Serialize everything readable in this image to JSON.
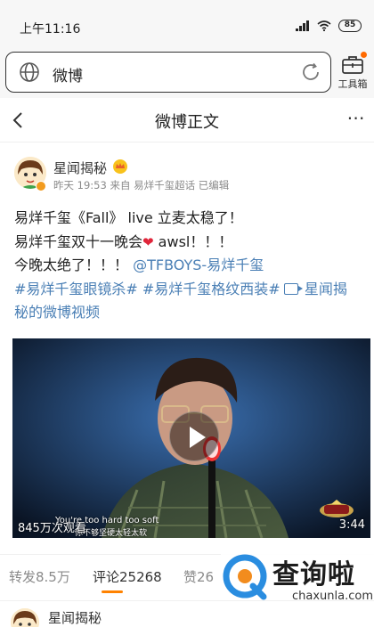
{
  "status_bar": {
    "time": "上午11:16",
    "battery": "85"
  },
  "browser": {
    "address": "微博",
    "toolbox_label": "工具箱"
  },
  "nav": {
    "title": "微博正文"
  },
  "post": {
    "author": "星闻揭秘",
    "meta": "昨天 19:53 来自 易烊千玺超话 已编辑",
    "line1": "易烊千玺《Fall》 live 立麦太稳了！",
    "line2_a": "易烊千玺双十一晚会",
    "heart": "❤",
    "line2_b": " awsl！！！",
    "line3_a": "今晚太绝了！！！ ",
    "mention": "@TFBOYS-易烊千玺",
    "tags_line": "#易烊千玺眼镜杀# #易烊千玺格纹西装#",
    "video_link_a": "星闻揭",
    "video_link_b": "秘的微博视频"
  },
  "video": {
    "view_count": "845万次观看",
    "duration": "3:44",
    "subtitle_en": "You're too hard too soft",
    "subtitle_cn": "你不够坚硬太轻太软"
  },
  "tabs": {
    "repost": "转发8.5万",
    "comment": "评论25268",
    "like": "赞26"
  },
  "watermark": {
    "text": "查询啦",
    "url": "chaxunla.com"
  },
  "comment_preview": {
    "author": "星闻揭秘"
  },
  "colors": {
    "link": "#4a7fb5",
    "accent": "#ff8200",
    "heart": "#e0253a"
  }
}
